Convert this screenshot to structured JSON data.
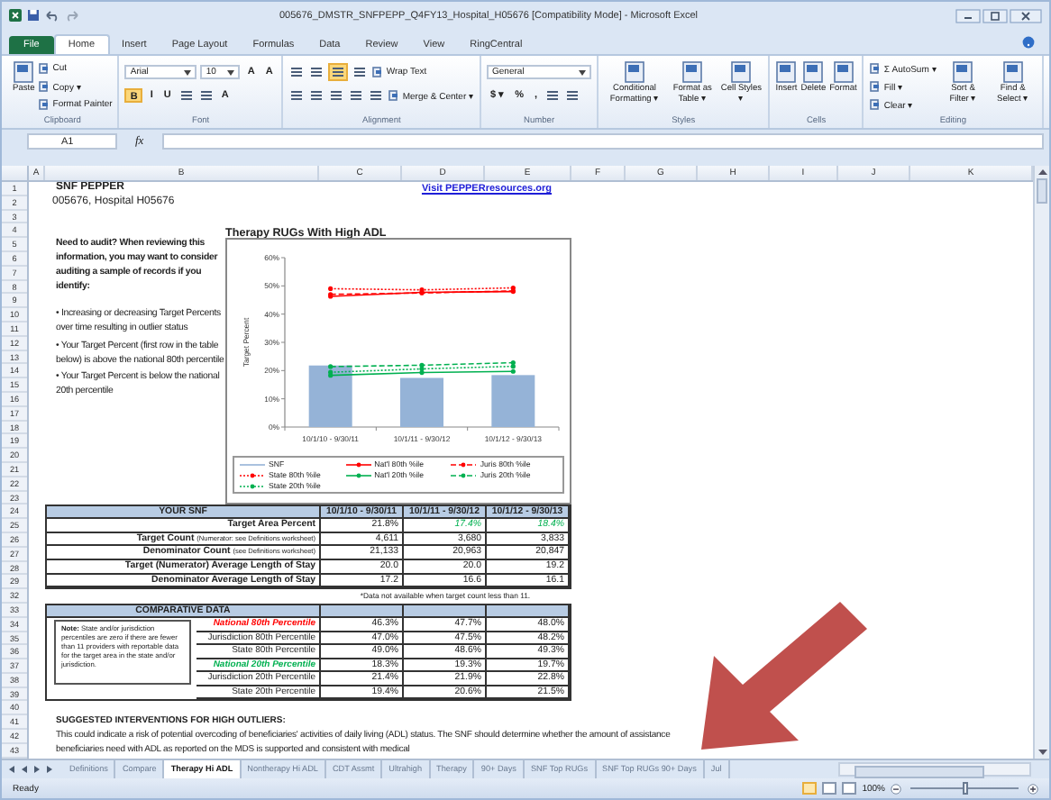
{
  "window": {
    "title": "005676_DMSTR_SNFPEPP_Q4FY13_Hospital_H05676  [Compatibility Mode] - Microsoft Excel"
  },
  "ribbon": {
    "tabs": [
      {
        "label": "File",
        "selected": false,
        "kind": "file"
      },
      {
        "label": "Home",
        "selected": true,
        "kind": "tab"
      },
      {
        "label": "Insert",
        "selected": false,
        "kind": "tab"
      },
      {
        "label": "Page Layout",
        "selected": false,
        "kind": "tab"
      },
      {
        "label": "Formulas",
        "selected": false,
        "kind": "tab"
      },
      {
        "label": "Data",
        "selected": false,
        "kind": "tab"
      },
      {
        "label": "Review",
        "selected": false,
        "kind": "tab"
      },
      {
        "label": "View",
        "selected": false,
        "kind": "tab"
      },
      {
        "label": "RingCentral",
        "selected": false,
        "kind": "tab"
      }
    ],
    "groups": [
      {
        "label": "Clipboard",
        "kind": "stack",
        "items": [
          {
            "kind": "large",
            "label": "Paste"
          },
          {
            "kind": "small",
            "label": "Cut"
          },
          {
            "kind": "small",
            "label": "Copy ▾"
          },
          {
            "kind": "small",
            "label": "Format Painter"
          }
        ]
      },
      {
        "label": "Font",
        "kind": "rows",
        "rows": [
          [
            {
              "kind": "field",
              "label": "Arial"
            },
            {
              "kind": "field",
              "label": "10"
            },
            {
              "kind": "glyph",
              "label": "A"
            },
            {
              "kind": "glyph",
              "label": "A"
            }
          ],
          [
            {
              "kind": "glyph",
              "label": "B",
              "on": true
            },
            {
              "kind": "glyph",
              "label": "I",
              "on": false
            },
            {
              "kind": "glyph",
              "label": "U",
              "on": false
            },
            {
              "kind": "icon",
              "on": false
            },
            {
              "kind": "icon",
              "on": false
            },
            {
              "kind": "glyph",
              "label": "A",
              "on": false
            }
          ]
        ]
      },
      {
        "label": "Alignment",
        "kind": "rows",
        "rows": [
          [
            {
              "kind": "icon",
              "on": false
            },
            {
              "kind": "icon",
              "on": false
            },
            {
              "kind": "icon",
              "on": true
            },
            {
              "kind": "icon",
              "on": false
            },
            {
              "kind": "small",
              "label": "Wrap Text"
            }
          ],
          [
            {
              "kind": "icon",
              "on": false
            },
            {
              "kind": "icon",
              "on": false
            },
            {
              "kind": "icon",
              "on": false
            },
            {
              "kind": "icon",
              "on": false
            },
            {
              "kind": "icon",
              "on": false
            },
            {
              "kind": "small",
              "label": "Merge & Center ▾"
            }
          ]
        ]
      },
      {
        "label": "Number",
        "kind": "rows",
        "rows": [
          [
            {
              "kind": "field",
              "label": "General"
            }
          ],
          [
            {
              "kind": "glyph",
              "label": "$ ▾"
            },
            {
              "kind": "glyph",
              "label": "%"
            },
            {
              "kind": "glyph",
              "label": ","
            },
            {
              "kind": "icon"
            },
            {
              "kind": "icon"
            }
          ]
        ]
      },
      {
        "label": "Styles",
        "kind": "stack",
        "items": [
          {
            "kind": "large",
            "label": "Conditional Formatting ▾"
          },
          {
            "kind": "large",
            "label": "Format as Table ▾"
          },
          {
            "kind": "large",
            "label": "Cell Styles ▾"
          }
        ]
      },
      {
        "label": "Cells",
        "kind": "stack",
        "items": [
          {
            "kind": "large",
            "label": "Insert"
          },
          {
            "kind": "large",
            "label": "Delete"
          },
          {
            "kind": "large",
            "label": "Format"
          }
        ]
      },
      {
        "label": "Editing",
        "kind": "stack",
        "items": [
          {
            "kind": "small",
            "label": "Σ AutoSum ▾"
          },
          {
            "kind": "small",
            "label": "Fill ▾"
          },
          {
            "kind": "small",
            "label": "Clear ▾"
          },
          {
            "kind": "large",
            "label": "Sort & Filter ▾"
          },
          {
            "kind": "large",
            "label": "Find & Select ▾"
          }
        ]
      }
    ]
  },
  "formula_bar": {
    "cell": "A1",
    "function_label": "fx"
  },
  "sheet": {
    "columns": [
      "A",
      "B",
      "C",
      "D",
      "E",
      "F",
      "G",
      "H",
      "I",
      "J",
      "K"
    ],
    "rows": [
      "1",
      "2",
      "3",
      "4",
      "5",
      "6",
      "7",
      "8",
      "9",
      "10",
      "11",
      "12",
      "13",
      "14",
      "15",
      "16",
      "17",
      "18",
      "19",
      "20",
      "21",
      "22",
      "23",
      "24",
      "25",
      "26",
      "27",
      "28",
      "29",
      "32",
      "33",
      "34",
      "35",
      "36",
      "37",
      "38",
      "39",
      "40",
      "41",
      "42",
      "43"
    ],
    "title": "SNF PEPPER",
    "subtitle": "005676, Hospital H05676",
    "link": "Visit PEPPERresources.org",
    "audit": {
      "heading": "Need to audit? When reviewing this information, you may want to consider auditing a sample of records if you identify:",
      "bullets": [
        "• Increasing or decreasing Target Percents over time resulting in outlier status",
        "• Your Target Percent (first row in the table below) is above the national 80th percentile",
        "• Your Target Percent is below the national 20th percentile"
      ]
    },
    "chart_title": "Therapy RUGs With High ADL",
    "chart_data": {
      "type": "bar",
      "ylabel": "Target Percent",
      "categories": [
        "10/1/10 - 9/30/11",
        "10/1/11 - 9/30/12",
        "10/1/12 - 9/30/13"
      ],
      "ylim": [
        0,
        60
      ],
      "yticks": [
        {
          "value": 0,
          "label": "0%"
        },
        {
          "value": 10,
          "label": "10%"
        },
        {
          "value": 20,
          "label": "20%"
        },
        {
          "value": 30,
          "label": "30%"
        },
        {
          "value": 40,
          "label": "40%"
        },
        {
          "value": 50,
          "label": "50%"
        },
        {
          "value": 60,
          "label": "60%"
        }
      ],
      "legend": "bottom",
      "series": [
        {
          "name": "SNF",
          "color": "#95b3d7",
          "values": [
            21.8,
            17.4,
            18.4
          ]
        },
        {
          "name": "Nat'l 80th %ile",
          "color": "#ff0000",
          "type": "line",
          "line_style": "solid",
          "values": [
            46.3,
            47.7,
            48.0
          ]
        },
        {
          "name": "Juris 80th %ile",
          "color": "#ff0000",
          "type": "line",
          "line_style": "dashed",
          "values": [
            47.0,
            47.5,
            48.2
          ]
        },
        {
          "name": "State 80th %ile",
          "color": "#ff0000",
          "type": "line",
          "line_style": "dotted",
          "values": [
            49.0,
            48.6,
            49.3
          ]
        },
        {
          "name": "Nat'l 20th %ile",
          "color": "#00b050",
          "type": "line",
          "line_style": "solid",
          "values": [
            18.3,
            19.3,
            19.7
          ]
        },
        {
          "name": "Juris 20th %ile",
          "color": "#00b050",
          "type": "line",
          "line_style": "dashed",
          "values": [
            21.4,
            21.9,
            22.8
          ]
        },
        {
          "name": "State 20th %ile",
          "color": "#00b050",
          "type": "line",
          "line_style": "dotted",
          "values": [
            19.4,
            20.6,
            21.5
          ]
        }
      ]
    },
    "snf_table": {
      "title": "YOUR SNF",
      "periods": [
        "10/1/10 - 9/30/11",
        "10/1/11 - 9/30/12",
        "10/1/12 - 9/30/13"
      ],
      "rows": [
        {
          "label": "Target Area Percent",
          "cells": [
            {
              "text": "21.8%",
              "highlighted": false
            },
            {
              "text": "17.4%",
              "highlighted": true
            },
            {
              "text": "18.4%",
              "highlighted": true
            }
          ]
        },
        {
          "label": "Target Count",
          "note": "(Numerator: see Definitions worksheet)",
          "cells": [
            {
              "text": "4,611",
              "highlighted": false
            },
            {
              "text": "3,680",
              "highlighted": false
            },
            {
              "text": "3,833",
              "highlighted": false
            }
          ]
        },
        {
          "label": "Denominator Count",
          "note": "(see Definitions worksheet)",
          "cells": [
            {
              "text": "21,133",
              "highlighted": false
            },
            {
              "text": "20,963",
              "highlighted": false
            },
            {
              "text": "20,847",
              "highlighted": false
            }
          ]
        },
        {
          "label": "Target (Numerator) Average Length of Stay",
          "cells": [
            {
              "text": "20.0",
              "highlighted": false
            },
            {
              "text": "20.0",
              "highlighted": false
            },
            {
              "text": "19.2",
              "highlighted": false
            }
          ]
        },
        {
          "label": "Denominator Average Length of Stay",
          "cells": [
            {
              "text": "17.2",
              "highlighted": false
            },
            {
              "text": "16.6",
              "highlighted": false
            },
            {
              "text": "16.1",
              "highlighted": false
            }
          ]
        }
      ],
      "footnote": "*Data not available when target count less than 11."
    },
    "comparative_table": {
      "title": "COMPARATIVE DATA",
      "note": "**Note:** State and/or jurisdiction percentiles are zero if there are fewer than 11 providers with reportable data for the target area in the state and/or jurisdiction.",
      "rows": [
        {
          "label": "National 80th Percentile",
          "kind": "high",
          "cells": [
            "46.3%",
            "47.7%",
            "48.0%"
          ]
        },
        {
          "label": "Jurisdiction 80th Percentile",
          "kind": "plain",
          "cells": [
            "47.0%",
            "47.5%",
            "48.2%"
          ]
        },
        {
          "label": "State 80th Percentile",
          "kind": "plain",
          "cells": [
            "49.0%",
            "48.6%",
            "49.3%"
          ]
        },
        {
          "label": "National 20th Percentile",
          "kind": "low",
          "cells": [
            "18.3%",
            "19.3%",
            "19.7%"
          ]
        },
        {
          "label": "Jurisdiction 20th Percentile",
          "kind": "plain",
          "cells": [
            "21.4%",
            "21.9%",
            "22.8%"
          ]
        },
        {
          "label": "State 20th Percentile",
          "kind": "plain",
          "cells": [
            "19.4%",
            "20.6%",
            "21.5%"
          ]
        }
      ]
    },
    "interventions": {
      "heading": "SUGGESTED INTERVENTIONS FOR HIGH OUTLIERS:",
      "text": "This could indicate a risk of potential overcoding of beneficiaries' activities of daily living (ADL) status. The SNF should determine whether the amount of assistance beneficiaries need with ADL as reported on the MDS is supported and consistent with medical"
    }
  },
  "sheet_tabs": [
    {
      "label": "Definitions",
      "selected": false
    },
    {
      "label": "Compare",
      "selected": false
    },
    {
      "label": "Therapy Hi ADL",
      "selected": true
    },
    {
      "label": "Nontherapy Hi ADL",
      "selected": false
    },
    {
      "label": "CDT Assmt",
      "selected": false
    },
    {
      "label": "Ultrahigh",
      "selected": false
    },
    {
      "label": "Therapy",
      "selected": false
    },
    {
      "label": "90+ Days",
      "selected": false
    },
    {
      "label": "SNF Top RUGs",
      "selected": false
    },
    {
      "label": "SNF Top RUGs 90+ Days",
      "selected": false
    },
    {
      "label": "Jul",
      "selected": false
    }
  ],
  "status_bar": {
    "text": "Ready",
    "views": [
      {
        "selected": true
      },
      {
        "selected": false
      },
      {
        "selected": false
      }
    ],
    "zoom": {
      "label": "100%",
      "level": 0.5
    }
  }
}
